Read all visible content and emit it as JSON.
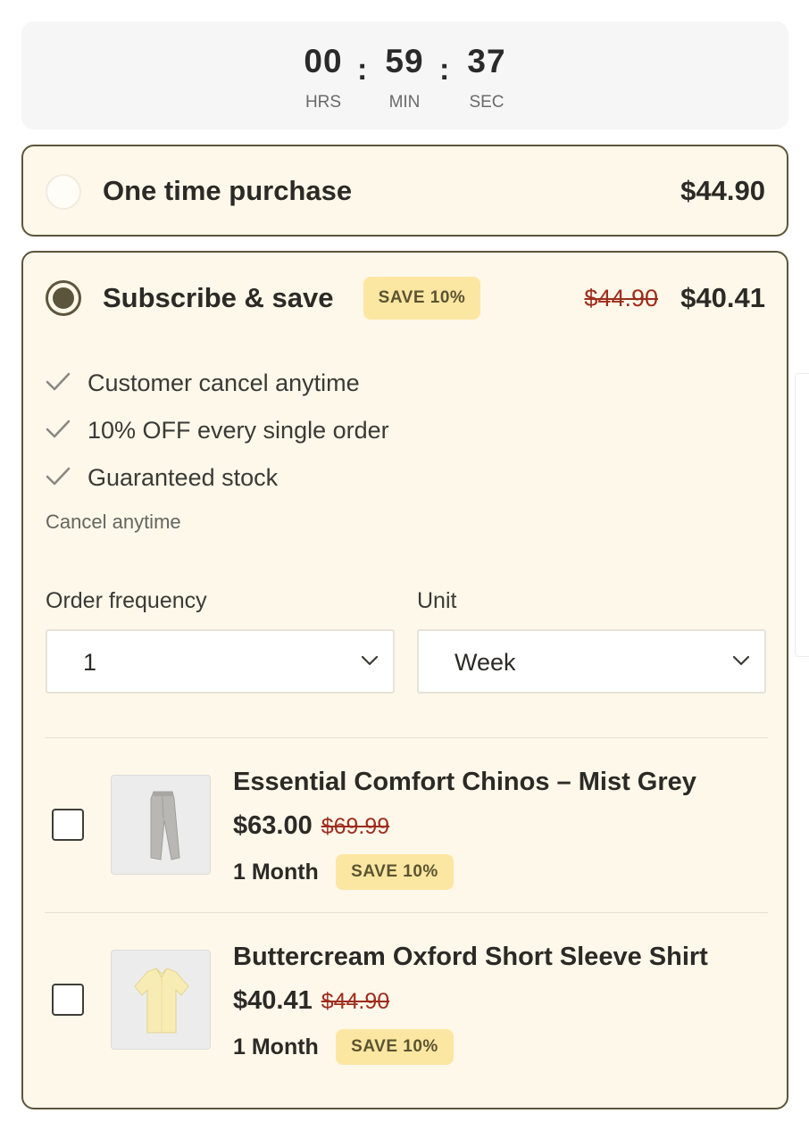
{
  "timer": {
    "hours": "00",
    "minutes": "59",
    "seconds": "37",
    "hours_label": "HRS",
    "minutes_label": "MIN",
    "seconds_label": "SEC",
    "separator": ":"
  },
  "one_time": {
    "title": "One time purchase",
    "price": "$44.90",
    "selected": false
  },
  "subscribe": {
    "title": "Subscribe & save",
    "badge": "SAVE 10%",
    "old_price": "$44.90",
    "price": "$40.41",
    "selected": true,
    "benefits": [
      "Customer cancel anytime",
      "10% OFF every single order",
      "Guaranteed stock"
    ],
    "note": "Cancel anytime",
    "frequency": {
      "label": "Order frequency",
      "value": "1"
    },
    "unit": {
      "label": "Unit",
      "value": "Week"
    }
  },
  "products": [
    {
      "name": "Essential Comfort Chinos – Mist Grey",
      "price": "$63.00",
      "old_price": "$69.99",
      "frequency": "1 Month",
      "badge": "SAVE 10%",
      "checked": false,
      "image": "grey-chinos"
    },
    {
      "name": "Buttercream Oxford Short Sleeve Shirt",
      "price": "$40.41",
      "old_price": "$44.90",
      "frequency": "1 Month",
      "badge": "SAVE 10%",
      "checked": false,
      "image": "yellow-shirt"
    }
  ],
  "colors": {
    "card_bg": "#fef8ea",
    "card_border": "#5b553c",
    "badge_bg": "#fbe7a2",
    "strike_price": "#9d2d1d"
  }
}
